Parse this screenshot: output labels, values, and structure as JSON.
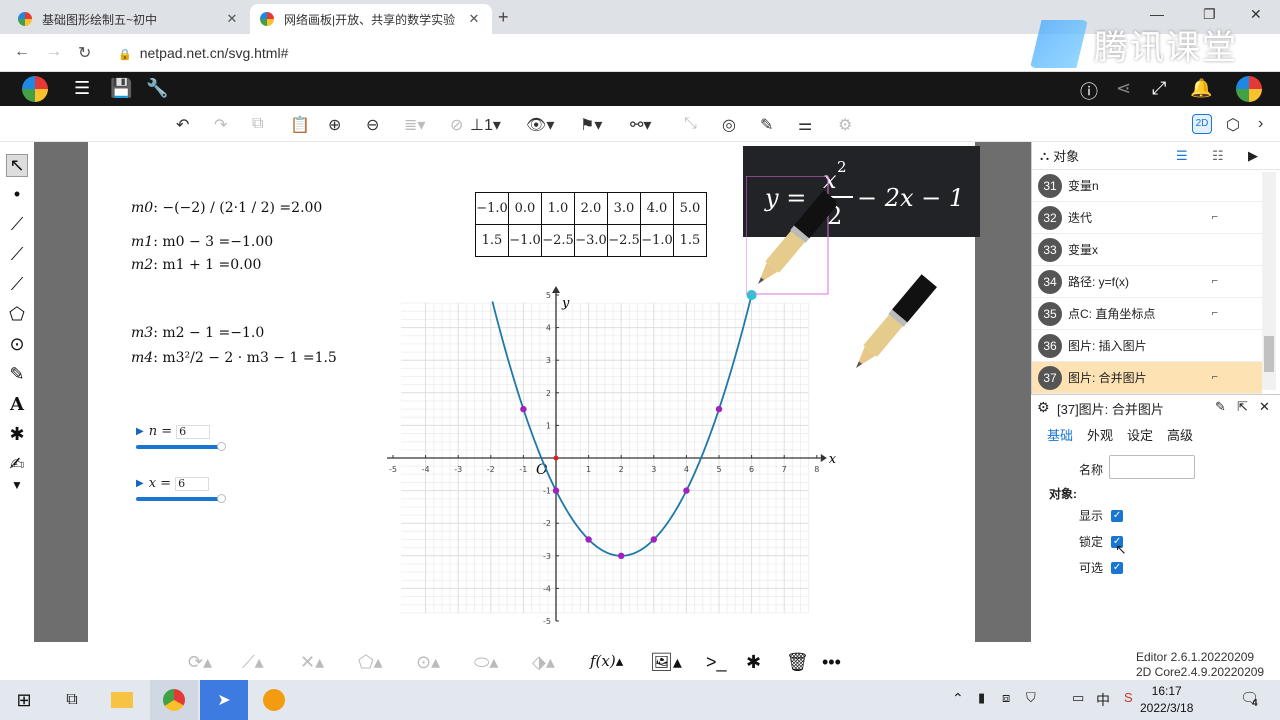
{
  "browser": {
    "tabs": [
      {
        "title": "基础图形绘制五~初中",
        "active": false
      },
      {
        "title": "网络画板|开放、共享的数学实验",
        "active": true
      }
    ],
    "url": "netpad.net.cn/svg.html#",
    "brand_watermark": "腾讯课堂"
  },
  "toolbar": {
    "line_style_label": "1"
  },
  "canvas": {
    "equations": [
      {
        "name": "m0",
        "expr": ": −(−2) / (2·1 / 2) =",
        "value": "2.00"
      },
      {
        "name": "m1",
        "expr": ": m0 − 3 =",
        "value": "−1.00"
      },
      {
        "name": "m2",
        "expr": ": m1 + 1 =",
        "value": "0.00"
      },
      {
        "name": "m3",
        "expr": ": m2 − 1 =",
        "value": "−1.0"
      },
      {
        "name": "m4",
        "expr": ": m3²/2 − 2 · m3 − 1 =",
        "value": "1.5"
      }
    ],
    "table": {
      "row1": [
        "−1.0",
        "0.0",
        "1.0",
        "2.0",
        "3.0",
        "4.0",
        "5.0"
      ],
      "row2": [
        "1.5",
        "−1.0",
        "−2.5",
        "−3.0",
        "−2.5",
        "−1.0",
        "1.5"
      ]
    },
    "sliders": [
      {
        "var": "n",
        "value": "6"
      },
      {
        "var": "x",
        "value": "6"
      }
    ],
    "formula": {
      "lhs": "y =",
      "num": "x",
      "exp": "2",
      "den": "2",
      "rest": "− 2x − 1"
    }
  },
  "chart_data": {
    "type": "line",
    "xlabel": "x",
    "ylabel": "y",
    "origin_label": "O",
    "xlim": [
      -5,
      8
    ],
    "ylim": [
      -5,
      5
    ],
    "x_ticks": [
      "-5",
      "-4",
      "-3",
      "-2",
      "-1",
      "1",
      "2",
      "3",
      "4",
      "5",
      "6",
      "7",
      "8"
    ],
    "y_ticks": [
      "5",
      "4",
      "3",
      "2",
      "1",
      "-1",
      "-2",
      "-3",
      "-4",
      "-5"
    ],
    "function": "y = x^2/2 - 2x - 1",
    "curve_x_range": [
      -1.95,
      6
    ],
    "grid": true,
    "points": [
      {
        "x": -1,
        "y": 1.5
      },
      {
        "x": 0,
        "y": -1
      },
      {
        "x": 1,
        "y": -2.5
      },
      {
        "x": 2,
        "y": -3
      },
      {
        "x": 3,
        "y": -2.5
      },
      {
        "x": 4,
        "y": -1
      },
      {
        "x": 5,
        "y": 1.5
      }
    ],
    "highlight_point": {
      "x": 6,
      "y": 5
    },
    "colors": {
      "curve": "#1f78a8",
      "point": "#a020c0",
      "highlight": "#20c8d0",
      "origin": "#e02020"
    }
  },
  "panel": {
    "header": "对象",
    "objects": [
      {
        "num": "31",
        "label": "变量n",
        "pin": false,
        "selected": false
      },
      {
        "num": "32",
        "label": "迭代",
        "pin": true,
        "selected": false
      },
      {
        "num": "33",
        "label": "变量x",
        "pin": false,
        "selected": false
      },
      {
        "num": "34",
        "label": "路径: y=f(x)",
        "pin": true,
        "selected": false
      },
      {
        "num": "35",
        "label": "点C: 直角坐标点",
        "pin": true,
        "selected": false
      },
      {
        "num": "36",
        "label": "图片: 插入图片",
        "pin": false,
        "selected": false
      },
      {
        "num": "37",
        "label": "图片: 合并图片",
        "pin": true,
        "selected": true
      }
    ],
    "props_title": "[37]图片: 合并图片",
    "props_tabs": [
      "基础",
      "外观",
      "设定",
      "高级"
    ],
    "name_label": "名称",
    "name_value": "",
    "object_section": "对象:",
    "checks": [
      {
        "label": "显示",
        "checked": true
      },
      {
        "label": "锁定",
        "checked": true
      },
      {
        "label": "可选",
        "checked": true
      }
    ]
  },
  "version": {
    "line1": "Editor 2.6.1.20220209",
    "line2": "2D Core2.4.9.20220209"
  },
  "taskbar": {
    "ime": "中",
    "time": "16:17",
    "date": "2022/3/18",
    "notifications": "4"
  }
}
